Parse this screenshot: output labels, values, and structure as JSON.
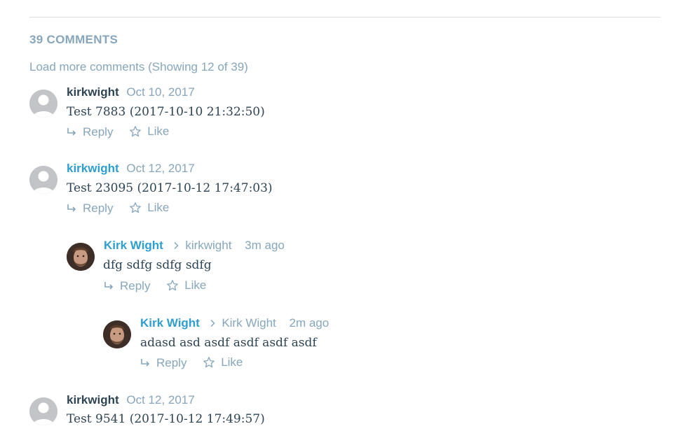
{
  "comments_header": {
    "count_label": "39 COMMENTS",
    "load_more_label": "Load more comments (Showing 12 of 39)"
  },
  "actions": {
    "reply_label": "Reply",
    "like_label": "Like"
  },
  "comments": [
    {
      "author": "kirkwight",
      "date": "Oct 10, 2017",
      "body": "Test 7883 (2017-10-10 21:32:50)",
      "avatar": "default-avatar-icon"
    },
    {
      "author": "kirkwight",
      "date": "Oct 12, 2017",
      "body": "Test 23095 (2017-10-12 17:47:03)",
      "avatar": "default-avatar-icon"
    },
    {
      "author": "Kirk Wight",
      "parent_author": "kirkwight",
      "date": "3m ago",
      "body": "dfg sdfg sdfg sdfg",
      "avatar": "user-photo"
    },
    {
      "author": "Kirk Wight",
      "parent_author": "Kirk Wight",
      "date": "2m ago",
      "body": "adasd asd asdf asdf asdf asdf",
      "avatar": "user-photo"
    },
    {
      "author": "kirkwight",
      "date": "Oct 12, 2017",
      "body": "Test 9541 (2017-10-12 17:49:57)",
      "avatar": "default-avatar-icon"
    }
  ],
  "colors": {
    "muted": "#87a6bc",
    "text": "#2e4453",
    "link": "#2e9ed1",
    "avatar_default": "#c3c4c7"
  }
}
